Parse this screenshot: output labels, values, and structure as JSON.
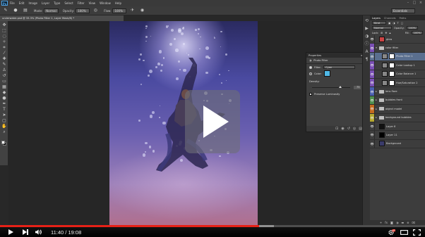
{
  "menubar": {
    "app_logo": "Ps",
    "items": [
      "File",
      "Edit",
      "Image",
      "Layer",
      "Type",
      "Select",
      "Filter",
      "View",
      "Window",
      "Help"
    ]
  },
  "optionsbar": {
    "mode_label": "Mode:",
    "mode_value": "Normal",
    "opacity_label": "Opacity:",
    "opacity_value": "100%",
    "flow_label": "Flow:",
    "flow_value": "100%",
    "workspace": "Essentials"
  },
  "document": {
    "tab_title": "underwater.psd @ 33.3% (Photo Filter 1, Layer Mask/8) *"
  },
  "properties_panel": {
    "header": "Properties",
    "title": "Photo Filter",
    "filter_label": "Filter:",
    "filter_value": "Cyan",
    "color_label": "Color:",
    "density_label": "Density:",
    "density_value": "75",
    "density_unit": "%",
    "density_fraction": 0.75,
    "preserve_label": "Preserve Luminosity",
    "color_hex": "#4fb8e6"
  },
  "right_panel": {
    "top_tabs": [
      "Layers",
      "Channels",
      "Paths"
    ],
    "kind_label": "Kind",
    "blend_mode": "Normal",
    "opacity_label": "Opacity:",
    "opacity_value": "100%",
    "lock_label": "Lock:",
    "fill_label": "Fill:",
    "fill_value": "100%"
  },
  "layers": [
    {
      "name": "glow",
      "kind": "layer",
      "tag": "",
      "thumb": "#c44"
    },
    {
      "name": "color filter",
      "kind": "group",
      "tag": "#7a4fb5"
    },
    {
      "name": "Photo Filter 1",
      "kind": "adjust",
      "tag": "#7a4fb5",
      "selected": true
    },
    {
      "name": "Color Lookup 1",
      "kind": "adjust",
      "tag": "#7a4fb5"
    },
    {
      "name": "Color Balance 1",
      "kind": "adjust",
      "tag": "#7a4fb5"
    },
    {
      "name": "Hue/Saturation 2",
      "kind": "adjust",
      "tag": "#7a4fb5"
    },
    {
      "name": "lens flare",
      "kind": "folder",
      "tag": "#4a5fb0"
    },
    {
      "name": "bubbles front",
      "kind": "folder",
      "tag": "#4f8f4f"
    },
    {
      "name": "object model",
      "kind": "folder",
      "tag": "#c46a1f"
    },
    {
      "name": "background bubbles",
      "kind": "folder",
      "tag": "#b5a82f"
    },
    {
      "name": "Layer 8",
      "kind": "layer",
      "tag": "",
      "thumb": "#111"
    },
    {
      "name": "Layer 11",
      "kind": "layer",
      "tag": "",
      "thumb": "#000"
    },
    {
      "name": "Background",
      "kind": "layer",
      "tag": "",
      "thumb": "#3a3b6a"
    }
  ],
  "video": {
    "current_time": "11:40",
    "duration": "19:08",
    "time_separator": " / ",
    "played_fraction": 0.61,
    "loaded_fraction": 0.645,
    "progress_color": "#e62117",
    "hd_badge": "HD"
  },
  "icons": {
    "play": "play-icon",
    "next": "next-icon",
    "volume": "volume-icon",
    "settings": "settings-icon",
    "theater": "theater-mode-icon",
    "fullscreen": "fullscreen-icon"
  }
}
